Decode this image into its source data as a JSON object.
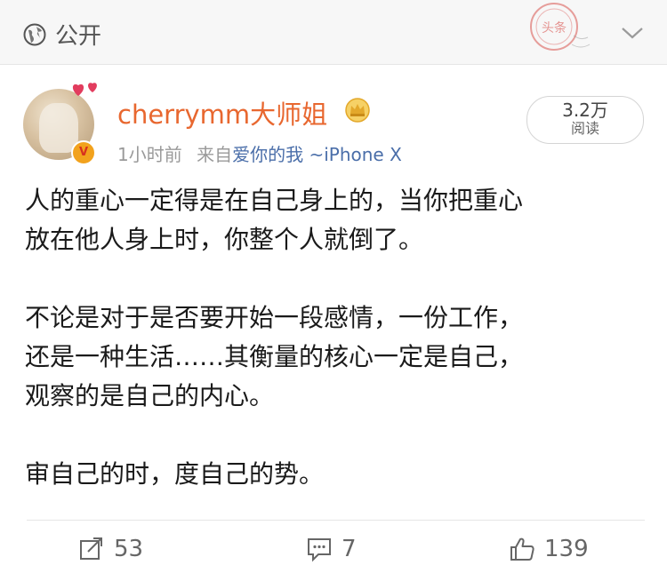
{
  "topbar": {
    "visibility_label": "公开",
    "visibility_icon": "globe-icon",
    "stamp_text": "头条",
    "expand_icon": "chevron-down-icon"
  },
  "post": {
    "username": "cherrymm大师姐",
    "badge_icon": "crown-icon",
    "verified_icon": "verified-v-icon",
    "verified_text": "V",
    "time": "1小时前",
    "from_label": "来自",
    "source": "爱你的我 ~iPhone X",
    "read_count": "3.2万",
    "read_label": "阅读",
    "paragraphs": [
      [
        "人的重心一定得是在自己身上的，当你把重心",
        "放在他人身上时，你整个人就倒了。"
      ],
      [
        "不论是对于是否要开始一段感情，一份工作，",
        "还是一种生活……其衡量的核心一定是自己，",
        "观察的是自己的内心。"
      ],
      [
        "审自己的时，度自己的势。"
      ]
    ]
  },
  "actions": {
    "repost": {
      "icon": "share-icon",
      "count": "53"
    },
    "comment": {
      "icon": "comment-icon",
      "count": "7"
    },
    "like": {
      "icon": "thumbs-up-icon",
      "count": "139"
    }
  },
  "colors": {
    "username": "#e8672f",
    "source_link": "#4a6ea9",
    "meta_gray": "#9a9a9a",
    "topbar_bg": "#f7f7f7",
    "stamp_red": "#d9534f"
  }
}
